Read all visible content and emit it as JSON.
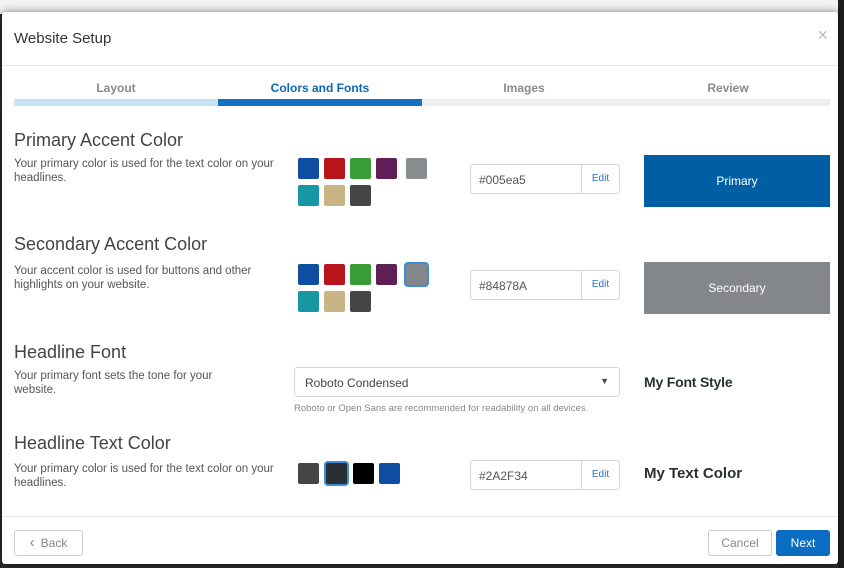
{
  "modal": {
    "title": "Website Setup",
    "close_icon": "×"
  },
  "steps": [
    {
      "label": "Layout",
      "state": "done"
    },
    {
      "label": "Colors and Fonts",
      "state": "active"
    },
    {
      "label": "Images",
      "state": "todo"
    },
    {
      "label": "Review",
      "state": "todo"
    }
  ],
  "primary": {
    "title": "Primary Accent Color",
    "description": "Your primary color is used for the text color on your headlines.",
    "swatches": [
      "#0f4ea3",
      "#b8141c",
      "#3a9c35",
      "#5d1f55",
      "#8a8d90",
      "#1697a3",
      "#c8b484",
      "#454545"
    ],
    "hex": "#005ea5",
    "edit_label": "Edit",
    "preview_label": "Primary",
    "preview_color": "#005ea5"
  },
  "secondary": {
    "title": "Secondary Accent Color",
    "description": "Your accent color is used for buttons and other highlights on your website.",
    "swatches": [
      "#0f4ea3",
      "#b8141c",
      "#3a9c35",
      "#5d1f55",
      "#84878a",
      "#1697a3",
      "#c8b484",
      "#454545"
    ],
    "hex": "#84878A",
    "edit_label": "Edit",
    "preview_label": "Secondary",
    "preview_color": "#84878A"
  },
  "headline_font": {
    "title": "Headline Font",
    "description": "Your primary font sets the tone for your website.",
    "selected": "Roboto Condensed",
    "hint": "Roboto or Open Sans are recommended for readability on all devices.",
    "sample": "My Font Style"
  },
  "headline_text_color": {
    "title": "Headline Text Color",
    "description": "Your primary color is used for the text color on your headlines.",
    "swatches": [
      "#454545",
      "#2a2f34",
      "#000000",
      "#0f4ea3"
    ],
    "hex": "#2A2F34",
    "edit_label": "Edit",
    "sample": "My Text Color"
  },
  "footer": {
    "back_label": "Back",
    "back_icon": "‹",
    "cancel_label": "Cancel",
    "next_label": "Next"
  }
}
